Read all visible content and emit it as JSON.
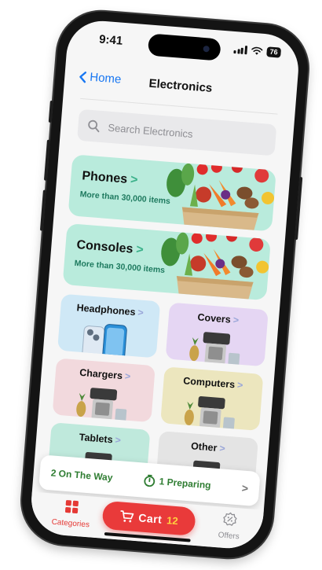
{
  "status_bar": {
    "time": "9:41",
    "battery": "76"
  },
  "nav": {
    "back_label": "Home",
    "title": "Electronics"
  },
  "search": {
    "placeholder": "Search Electronics"
  },
  "banners": [
    {
      "title": "Phones",
      "subtitle": "More than 30,000 items"
    },
    {
      "title": "Consoles",
      "subtitle": "More than 30,000 items"
    }
  ],
  "tiles": [
    {
      "label": "Headphones",
      "bg": "#cfe8f6",
      "image": "phone-image"
    },
    {
      "label": "Covers",
      "bg": "#e5d6f3",
      "image": "juicer-image"
    },
    {
      "label": "Chargers",
      "bg": "#f2d9dd",
      "image": "juicer-image"
    },
    {
      "label": "Computers",
      "bg": "#ece6be",
      "image": "juicer-image"
    },
    {
      "label": "Tablets",
      "bg": "#bfe9dc",
      "image": "juicer-image"
    },
    {
      "label": "Other",
      "bg": "#e4e4e4",
      "image": "juicer-image"
    }
  ],
  "order_status": {
    "on_the_way": "2 On The Way",
    "preparing": "1 Preparing"
  },
  "tab_bar": {
    "categories_label": "Categories",
    "cart_label": "Cart",
    "cart_count": "12",
    "offers_label": "Offers"
  },
  "colors": {
    "accent": "#e93a3a",
    "link": "#1877f2",
    "status_green": "#2f7d32",
    "banner_bg": "#b9ebdc"
  }
}
